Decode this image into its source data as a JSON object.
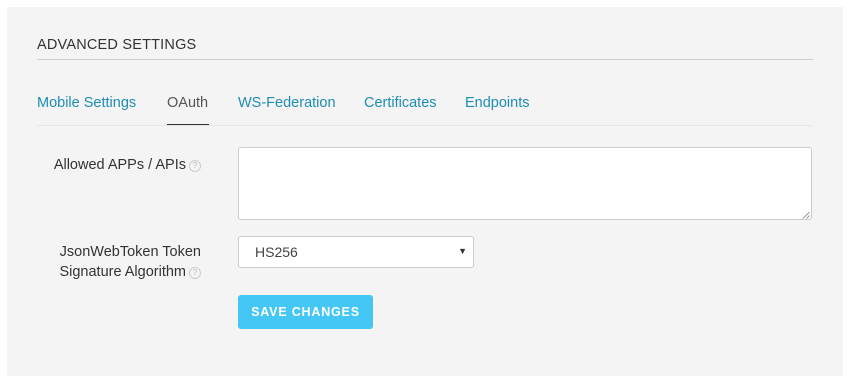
{
  "section": {
    "title": "ADVANCED SETTINGS"
  },
  "tabs": [
    {
      "label": "Mobile Settings",
      "active": false
    },
    {
      "label": "OAuth",
      "active": true
    },
    {
      "label": "WS-Federation",
      "active": false
    },
    {
      "label": "Certificates",
      "active": false
    },
    {
      "label": "Endpoints",
      "active": false
    }
  ],
  "fields": {
    "allowed_apps": {
      "label": "Allowed APPs / APIs",
      "value": "",
      "help_icon": "question-circle-icon"
    },
    "jwt_algorithm": {
      "label_line1": "JsonWebToken Token",
      "label_line2": "Signature Algorithm",
      "selected": "HS256",
      "help_icon": "question-circle-icon"
    }
  },
  "actions": {
    "save_label": "SAVE CHANGES"
  },
  "colors": {
    "panel_background": "#f4f4f4",
    "tab_link": "#1e8db3",
    "tab_active": "#555555",
    "primary_button": "#44c7f4"
  }
}
